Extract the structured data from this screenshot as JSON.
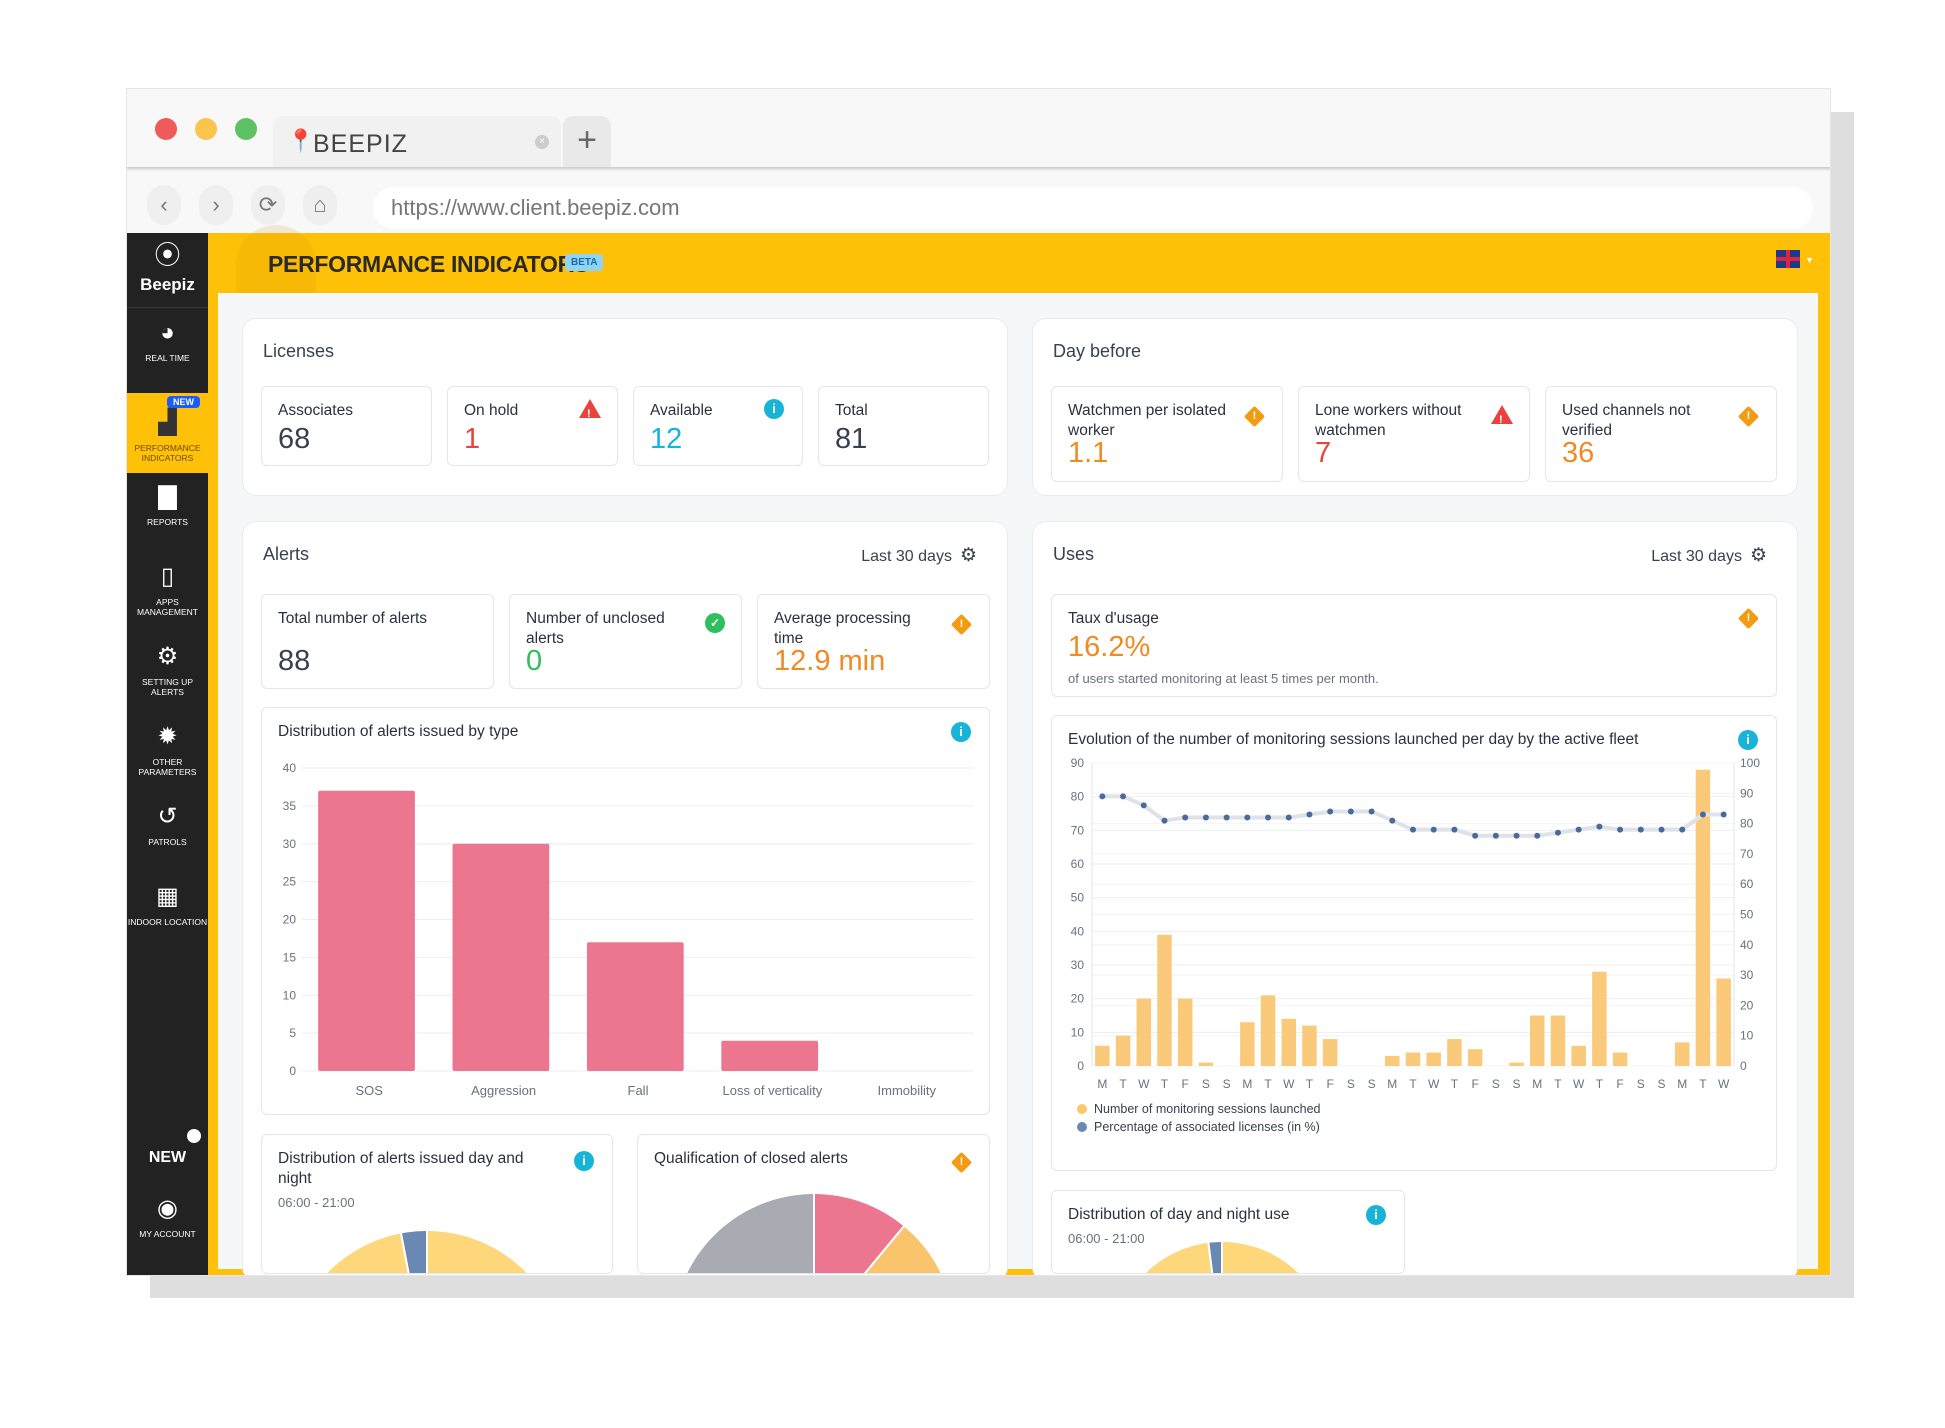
{
  "browser": {
    "tab_title": "BEEPIZ",
    "url": "https://www.client.beepiz.com",
    "new_tab": "+",
    "tab_close": "×"
  },
  "sidebar": {
    "brand": "Beepiz",
    "items": [
      {
        "label": "REAL TIME",
        "icon": "pie-chart-icon"
      },
      {
        "label": "PERFORMANCE INDICATORS",
        "icon": "bar-chart-icon",
        "badge": "NEW",
        "active": true
      },
      {
        "label": "REPORTS",
        "icon": "document-icon"
      },
      {
        "label": "APPS MANAGEMENT",
        "icon": "phone-icon"
      },
      {
        "label": "SETTING UP ALERTS",
        "icon": "gears-icon"
      },
      {
        "label": "OTHER PARAMETERS",
        "icon": "gear-icon"
      },
      {
        "label": "PATROLS",
        "icon": "history-icon"
      },
      {
        "label": "INDOOR LOCATION",
        "icon": "building-icon"
      }
    ],
    "new_label": "NEW",
    "account_label": "MY ACCOUNT"
  },
  "header": {
    "title": "PERFORMANCE INDICATORS",
    "badge": "BETA",
    "language": "en-GB"
  },
  "colors": {
    "accent": "#FFC107",
    "bar_alerts": "#EC7690",
    "bar_sessions": "#F9C46B",
    "line": "#4A6A9A",
    "info": "#17B4D8",
    "warning": "#F39C12",
    "danger": "#E8433E",
    "success": "#2EC05C"
  },
  "licenses": {
    "title": "Licenses",
    "items": [
      {
        "label": "Associates",
        "value": "68"
      },
      {
        "label": "On hold",
        "value": "1",
        "status": "danger"
      },
      {
        "label": "Available",
        "value": "12",
        "status": "info"
      },
      {
        "label": "Total",
        "value": "81"
      }
    ]
  },
  "day_before": {
    "title": "Day before",
    "items": [
      {
        "label": "Watchmen per isolated worker",
        "value": "1.1",
        "status": "warning"
      },
      {
        "label": "Lone workers without watchmen",
        "value": "7",
        "status": "danger"
      },
      {
        "label": "Used channels not verified",
        "value": "36",
        "status": "warning"
      }
    ]
  },
  "alerts": {
    "title": "Alerts",
    "period": "Last 30 days",
    "items": [
      {
        "label": "Total number of alerts",
        "value": "88"
      },
      {
        "label": "Number of unclosed alerts",
        "value": "0",
        "status": "success"
      },
      {
        "label": "Average processing time",
        "value": "12.9 min",
        "status": "warning"
      }
    ],
    "day_night": {
      "title": "Distribution of alerts issued day and night",
      "subtitle": "06:00 - 21:00"
    },
    "qualification": {
      "title": "Qualification of closed alerts"
    }
  },
  "uses": {
    "title": "Uses",
    "period": "Last 30 days",
    "rate": {
      "label": "Taux d'usage",
      "value": "16.2%",
      "caption": "of users started monitoring at least 5 times per month."
    },
    "day_night": {
      "title": "Distribution of day and night use",
      "subtitle": "06:00 - 21:00"
    }
  },
  "chart_data": [
    {
      "type": "bar",
      "title": "Distribution of alerts issued by type",
      "categories": [
        "SOS",
        "Aggression",
        "Fall",
        "Loss of verticality",
        "Immobility"
      ],
      "values": [
        37,
        30,
        17,
        4,
        0
      ],
      "ylim": [
        0,
        40
      ],
      "yticks": [
        0,
        5,
        10,
        15,
        20,
        25,
        30,
        35,
        40
      ],
      "grid": true
    },
    {
      "type": "bar+line",
      "title": "Evolution of the number of monitoring sessions launched per day by the active fleet",
      "categories": [
        "M",
        "T",
        "W",
        "T",
        "F",
        "S",
        "S",
        "M",
        "T",
        "W",
        "T",
        "F",
        "S",
        "S",
        "M",
        "T",
        "W",
        "T",
        "F",
        "S",
        "S",
        "M",
        "T",
        "W",
        "T",
        "F",
        "S",
        "S",
        "M",
        "T",
        "W"
      ],
      "series": [
        {
          "name": "Number of monitoring sessions launched",
          "type": "bar",
          "axis": "left",
          "values": [
            6,
            9,
            20,
            39,
            20,
            1,
            0,
            13,
            21,
            14,
            12,
            8,
            0,
            0,
            3,
            4,
            4,
            8,
            5,
            0,
            1,
            15,
            15,
            6,
            28,
            4,
            0,
            0,
            7,
            88,
            26
          ]
        },
        {
          "name": "Percentage of associated licenses (in %)",
          "type": "line",
          "axis": "right",
          "values": [
            89,
            89,
            86,
            81,
            82,
            82,
            82,
            82,
            82,
            82,
            83,
            84,
            84,
            84,
            81,
            78,
            78,
            78,
            76,
            76,
            76,
            76,
            77,
            78,
            79,
            78,
            78,
            78,
            78,
            83,
            83
          ]
        }
      ],
      "ylim_left": [
        0,
        90
      ],
      "ylim_right": [
        0,
        100
      ],
      "yticks_left": [
        0,
        10,
        20,
        30,
        40,
        50,
        60,
        70,
        80,
        90
      ],
      "yticks_right": [
        0,
        10,
        20,
        30,
        40,
        50,
        60,
        70,
        80,
        90,
        100
      ],
      "legend": "bottom-left",
      "grid": true
    },
    {
      "type": "pie",
      "title": "Distribution of alerts issued day and night",
      "values": [
        97,
        3
      ],
      "colors": [
        "#FDD77A",
        "#6A88B4"
      ]
    },
    {
      "type": "pie",
      "title": "Qualification of closed alerts",
      "values": [
        11,
        39,
        50
      ],
      "colors": [
        "#EC7690",
        "#F9C46B",
        "#A8ABB2"
      ],
      "donut": true
    },
    {
      "type": "pie",
      "title": "Distribution of day and night use",
      "values": [
        98,
        2
      ],
      "colors": [
        "#FDD77A",
        "#6A88B4"
      ]
    }
  ]
}
